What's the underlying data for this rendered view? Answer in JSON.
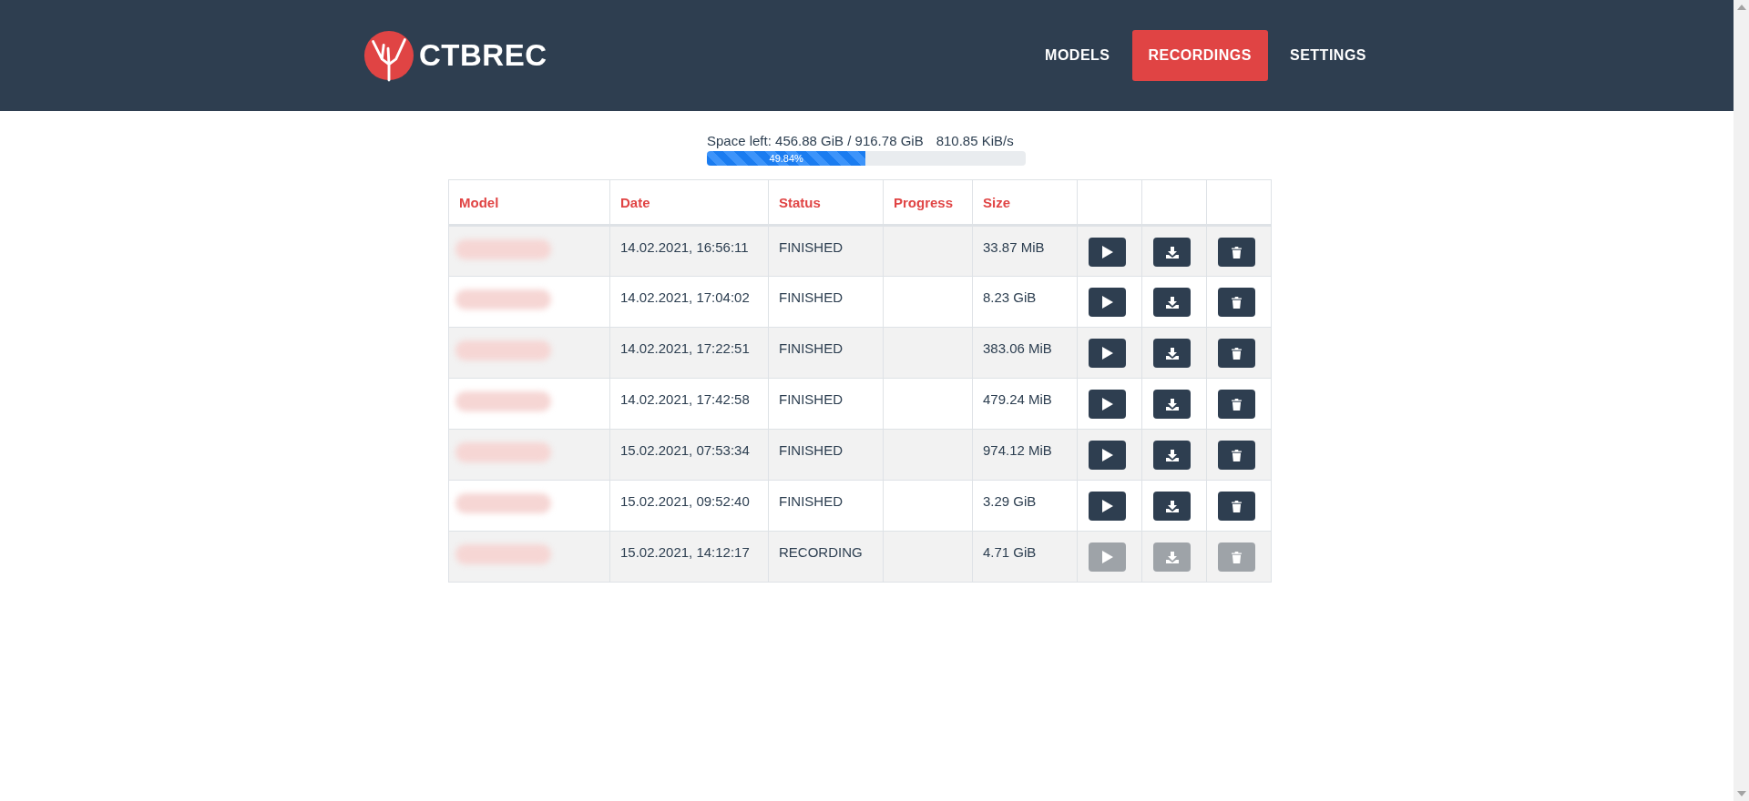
{
  "brand": {
    "name": "CTBREC"
  },
  "nav": [
    {
      "label": "MODELS",
      "selected": false
    },
    {
      "label": "RECORDINGS",
      "selected": true
    },
    {
      "label": "SETTINGS",
      "selected": false
    }
  ],
  "space": {
    "text": "Space left: 456.88 GiB / 916.78 GiB",
    "rate": "810.85 KiB/s",
    "level": 0.4984,
    "percent": "49.84%"
  },
  "table": {
    "columns": [
      "Model",
      "Date",
      "Status",
      "Progress",
      "Size"
    ],
    "rows": [
      {
        "model_redacted": true,
        "date": "14.02.2021, 16:56:11",
        "status": "FINISHED",
        "size": "33.87 MiB",
        "disabled": false
      },
      {
        "model_redacted": true,
        "date": "14.02.2021, 17:04:02",
        "status": "FINISHED",
        "size": "8.23 GiB",
        "disabled": false
      },
      {
        "model_redacted": true,
        "date": "14.02.2021, 17:22:51",
        "status": "FINISHED",
        "size": "383.06 MiB",
        "disabled": false
      },
      {
        "model_redacted": true,
        "date": "14.02.2021, 17:42:58",
        "status": "FINISHED",
        "size": "479.24 MiB",
        "disabled": false
      },
      {
        "model_redacted": true,
        "date": "15.02.2021, 07:53:34",
        "status": "FINISHED",
        "size": "974.12 MiB",
        "disabled": false
      },
      {
        "model_redacted": true,
        "date": "15.02.2021, 09:52:40",
        "status": "FINISHED",
        "size": "3.29 GiB",
        "disabled": false
      },
      {
        "model_redacted": true,
        "date": "15.02.2021, 14:12:17",
        "status": "RECORDING",
        "size": "4.71 GiB",
        "disabled": true
      }
    ]
  }
}
